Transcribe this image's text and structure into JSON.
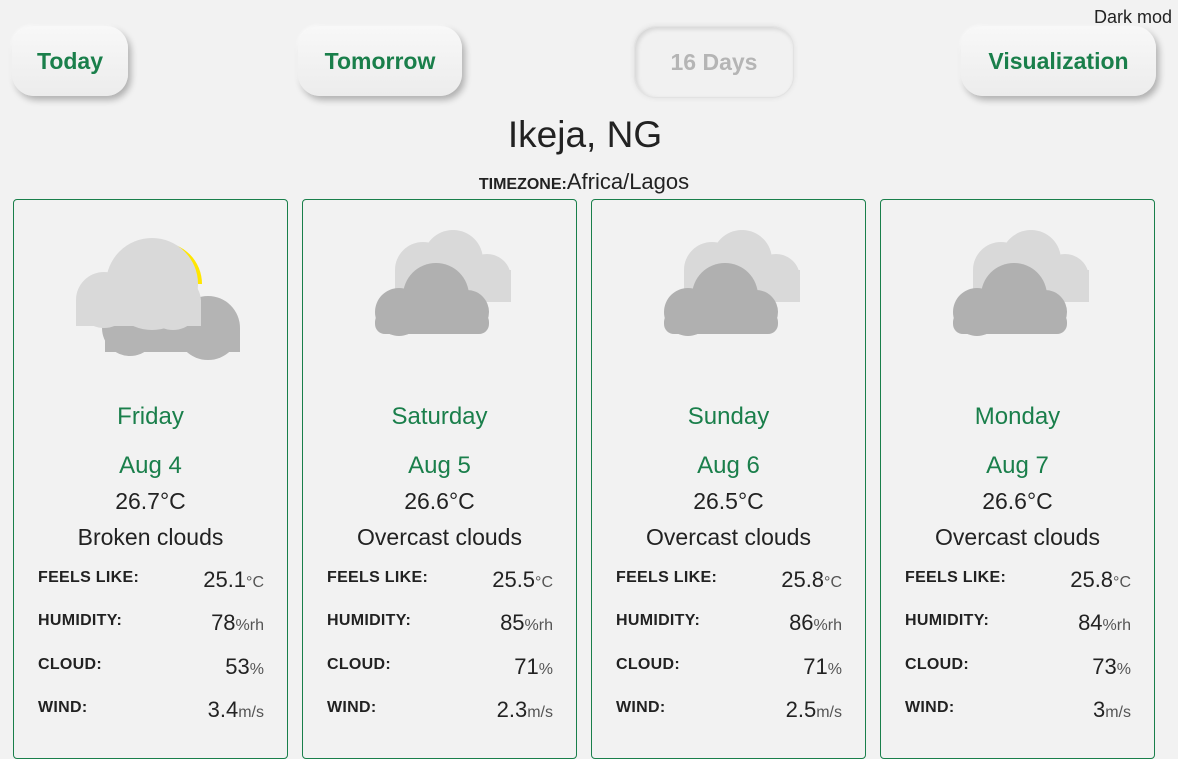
{
  "nav": {
    "today": "Today",
    "tomorrow": "Tomorrow",
    "days16": "16 Days",
    "visualization": "Visualization",
    "dark_mode": "Dark mod"
  },
  "location": {
    "city": "Ikeja, NG",
    "timezone_label": "TIMEZONE:",
    "timezone": "Africa/Lagos"
  },
  "labels": {
    "feels_like": "FEELS LIKE:",
    "humidity": "HUMIDITY:",
    "cloud": "CLOUD:",
    "wind": "WIND:"
  },
  "units": {
    "temp": "°C",
    "humidity": "%rh",
    "cloud": "%",
    "wind": "m/s"
  },
  "colors": {
    "accent": "#1a7f4b",
    "sun": "#ffe600",
    "cloud_light": "#d9d9d9",
    "cloud_dark": "#b0b0b0"
  },
  "days": [
    {
      "icon": "broken-clouds-icon",
      "day": "Friday",
      "date": "Aug 4",
      "temp": "26.7°C",
      "desc": "Broken clouds",
      "feels": "25.1",
      "humidity": "78",
      "cloud": "53",
      "wind": "3.4"
    },
    {
      "icon": "overcast-clouds-icon",
      "day": "Saturday",
      "date": "Aug 5",
      "temp": "26.6°C",
      "desc": "Overcast clouds",
      "feels": "25.5",
      "humidity": "85",
      "cloud": "71",
      "wind": "2.3"
    },
    {
      "icon": "overcast-clouds-icon",
      "day": "Sunday",
      "date": "Aug 6",
      "temp": "26.5°C",
      "desc": "Overcast clouds",
      "feels": "25.8",
      "humidity": "86",
      "cloud": "71",
      "wind": "2.5"
    },
    {
      "icon": "overcast-clouds-icon",
      "day": "Monday",
      "date": "Aug 7",
      "temp": "26.6°C",
      "desc": "Overcast clouds",
      "feels": "25.8",
      "humidity": "84",
      "cloud": "73",
      "wind": "3"
    }
  ]
}
